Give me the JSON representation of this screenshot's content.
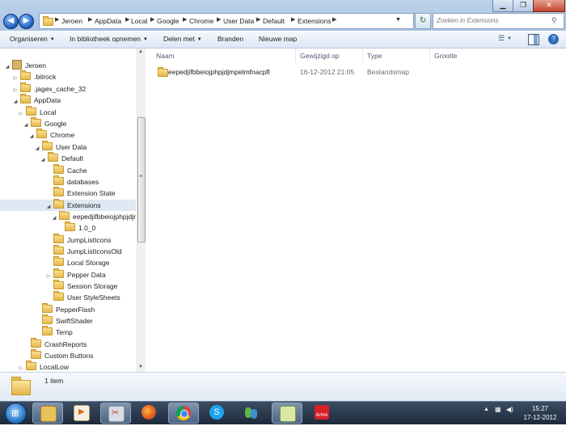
{
  "window": {
    "min": "▁",
    "max": "❐",
    "close": "✕"
  },
  "nav": {
    "back": "◀",
    "forward": "▶"
  },
  "breadcrumbs": [
    "Jeroen",
    "AppData",
    "Local",
    "Google",
    "Chrome",
    "User Data",
    "Default",
    "Extensions"
  ],
  "search": {
    "placeholder": "Zoeken in Extensions"
  },
  "toolbar": {
    "organize": "Organiseren",
    "library": "In bibliotheek opnemen",
    "share": "Delen met",
    "burn": "Branden",
    "newfolder": "Nieuwe map"
  },
  "tree": [
    {
      "label": "Jeroen"
    },
    {
      "label": ".bitrock"
    },
    {
      "label": ".jagex_cache_32"
    },
    {
      "label": "AppData"
    },
    {
      "label": "Local"
    },
    {
      "label": "Google"
    },
    {
      "label": "Chrome"
    },
    {
      "label": "User Data"
    },
    {
      "label": "Default"
    },
    {
      "label": "Cache"
    },
    {
      "label": "databases"
    },
    {
      "label": "Extension State"
    },
    {
      "label": "Extensions"
    },
    {
      "label": "eepedjifbbeiojphpjdjmp"
    },
    {
      "label": "1.0_0"
    },
    {
      "label": "JumpListIcons"
    },
    {
      "label": "JumpListIconsOld"
    },
    {
      "label": "Local Storage"
    },
    {
      "label": "Pepper Data"
    },
    {
      "label": "Session Storage"
    },
    {
      "label": "User StyleSheets"
    },
    {
      "label": "PepperFlash"
    },
    {
      "label": "SwiftShader"
    },
    {
      "label": "Temp"
    },
    {
      "label": "CrashReports"
    },
    {
      "label": "Custom Buttons"
    },
    {
      "label": "LocalLow"
    }
  ],
  "columns": {
    "name": "Naam",
    "modified": "Gewijzigd op",
    "type": "Type",
    "size": "Grootte"
  },
  "files": [
    {
      "name": "eepedjifbbeiojphpjdjmpelmfnacpfl",
      "modified": "16-12-2012 21:05",
      "type": "Bestandsmap",
      "size": ""
    }
  ],
  "status": {
    "count": "1 item"
  },
  "clock": {
    "time": "15:27",
    "date": "17-12-2012"
  },
  "colors": {
    "taskbar": "#22324a",
    "selection": "#dfe8f3",
    "folder": "#e6b94b"
  }
}
